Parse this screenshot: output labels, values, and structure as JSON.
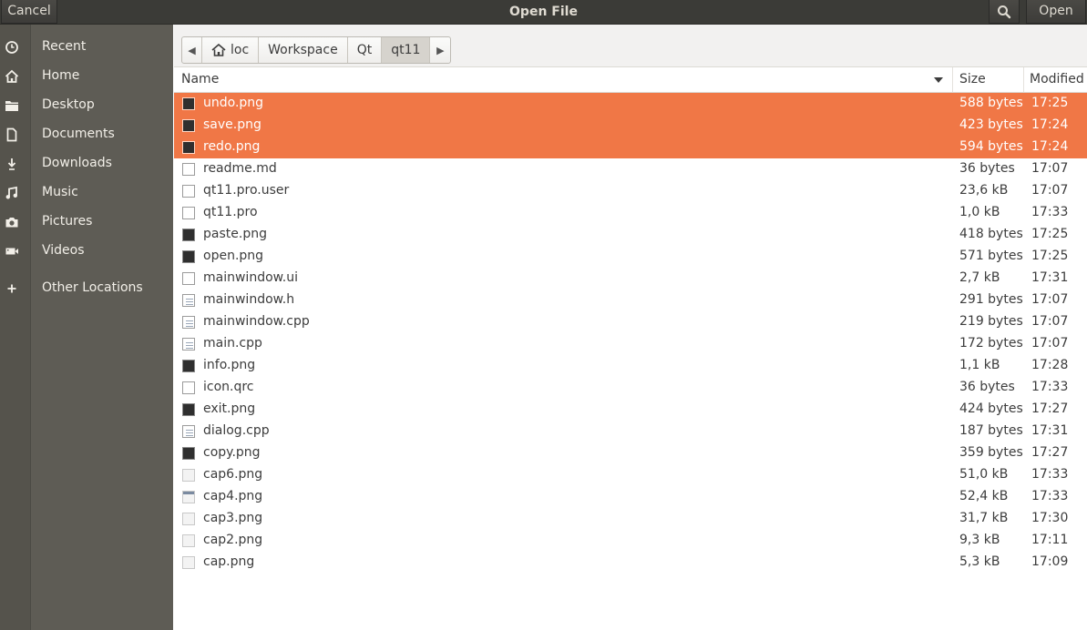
{
  "header": {
    "title": "Open File",
    "cancel_label": "Cancel",
    "open_label": "Open"
  },
  "sidebar": {
    "items": [
      {
        "label": "Recent",
        "icon": "clock-icon"
      },
      {
        "label": "Home",
        "icon": "home-icon"
      },
      {
        "label": "Desktop",
        "icon": "folder-icon"
      },
      {
        "label": "Documents",
        "icon": "document-icon"
      },
      {
        "label": "Downloads",
        "icon": "download-icon"
      },
      {
        "label": "Music",
        "icon": "music-icon"
      },
      {
        "label": "Pictures",
        "icon": "camera-icon"
      },
      {
        "label": "Videos",
        "icon": "video-icon"
      }
    ],
    "other_locations": "Other Locations"
  },
  "pathbar": {
    "crumbs": [
      "loc",
      "Workspace",
      "Qt",
      "qt11"
    ],
    "active": "qt11"
  },
  "columns": {
    "name": "Name",
    "size": "Size",
    "modified": "Modified"
  },
  "files": [
    {
      "name": "undo.png",
      "size": "588 bytes",
      "modified": "17:25",
      "type": "image",
      "selected": true
    },
    {
      "name": "save.png",
      "size": "423 bytes",
      "modified": "17:24",
      "type": "image",
      "selected": true
    },
    {
      "name": "redo.png",
      "size": "594 bytes",
      "modified": "17:24",
      "type": "image",
      "selected": true
    },
    {
      "name": "readme.md",
      "size": "36 bytes",
      "modified": "17:07",
      "type": "doc",
      "selected": false
    },
    {
      "name": "qt11.pro.user",
      "size": "23,6 kB",
      "modified": "17:07",
      "type": "user",
      "selected": false
    },
    {
      "name": "qt11.pro",
      "size": "1,0 kB",
      "modified": "17:33",
      "type": "doc",
      "selected": false
    },
    {
      "name": "paste.png",
      "size": "418 bytes",
      "modified": "17:25",
      "type": "image",
      "selected": false
    },
    {
      "name": "open.png",
      "size": "571 bytes",
      "modified": "17:25",
      "type": "image",
      "selected": false
    },
    {
      "name": "mainwindow.ui",
      "size": "2,7 kB",
      "modified": "17:31",
      "type": "doc",
      "selected": false
    },
    {
      "name": "mainwindow.h",
      "size": "291 bytes",
      "modified": "17:07",
      "type": "text",
      "selected": false
    },
    {
      "name": "mainwindow.cpp",
      "size": "219 bytes",
      "modified": "17:07",
      "type": "text",
      "selected": false
    },
    {
      "name": "main.cpp",
      "size": "172 bytes",
      "modified": "17:07",
      "type": "text",
      "selected": false
    },
    {
      "name": "info.png",
      "size": "1,1 kB",
      "modified": "17:28",
      "type": "image",
      "selected": false
    },
    {
      "name": "icon.qrc",
      "size": "36 bytes",
      "modified": "17:33",
      "type": "doc",
      "selected": false
    },
    {
      "name": "exit.png",
      "size": "424 bytes",
      "modified": "17:27",
      "type": "image",
      "selected": false
    },
    {
      "name": "dialog.cpp",
      "size": "187 bytes",
      "modified": "17:31",
      "type": "text",
      "selected": false
    },
    {
      "name": "copy.png",
      "size": "359 bytes",
      "modified": "17:27",
      "type": "image",
      "selected": false
    },
    {
      "name": "cap6.png",
      "size": "51,0 kB",
      "modified": "17:33",
      "type": "shot",
      "selected": false
    },
    {
      "name": "cap4.png",
      "size": "52,4 kB",
      "modified": "17:33",
      "type": "shot2",
      "selected": false
    },
    {
      "name": "cap3.png",
      "size": "31,7 kB",
      "modified": "17:30",
      "type": "shot",
      "selected": false
    },
    {
      "name": "cap2.png",
      "size": "9,3 kB",
      "modified": "17:11",
      "type": "shot",
      "selected": false
    },
    {
      "name": "cap.png",
      "size": "5,3 kB",
      "modified": "17:09",
      "type": "shot",
      "selected": false
    }
  ],
  "colors": {
    "selection": "#f07746",
    "header_bg": "#3b3b37",
    "sidebar_bg": "#5e5c55"
  }
}
